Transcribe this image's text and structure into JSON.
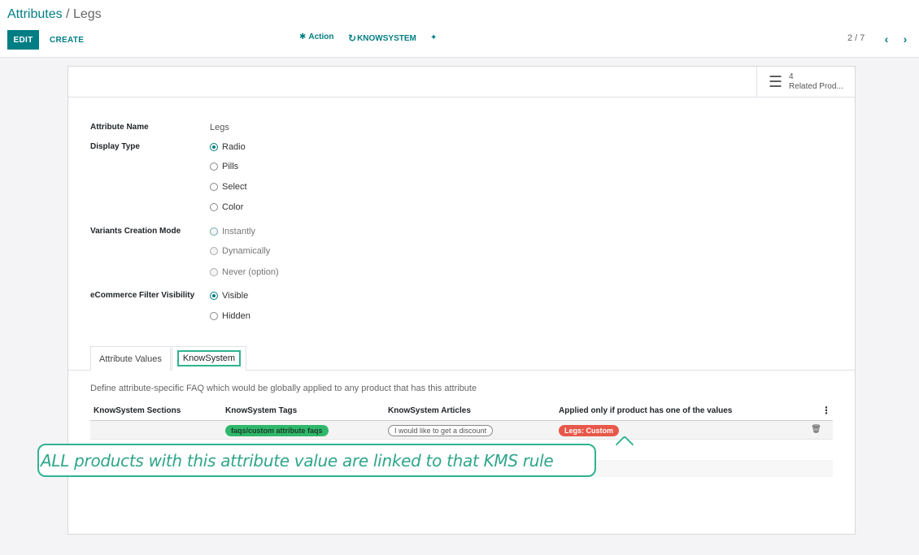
{
  "breadcrumb": {
    "parent": "Attributes",
    "separator": " / ",
    "current": "Legs"
  },
  "toolbar": {
    "edit_label": "EDIT",
    "create_label": "CREATE",
    "action_label": "Action",
    "knowsystem_label": "KNOWSYSTEM"
  },
  "pager": {
    "value": "2 / 7"
  },
  "smart_button": {
    "count": "4",
    "label": "Related Prod..."
  },
  "form": {
    "attribute_name": {
      "label": "Attribute Name",
      "value": "Legs"
    },
    "display_type": {
      "label": "Display Type",
      "options": [
        "Radio",
        "Pills",
        "Select",
        "Color"
      ],
      "selected": "Radio"
    },
    "variants_creation_mode": {
      "label": "Variants Creation Mode",
      "options": [
        "Instantly",
        "Dynamically",
        "Never (option)"
      ]
    },
    "ecommerce_filter": {
      "label": "eCommerce Filter Visibility",
      "options": [
        "Visible",
        "Hidden"
      ],
      "selected": "Visible"
    }
  },
  "tabs": [
    {
      "label": "Attribute Values"
    },
    {
      "label": "KnowSystem",
      "active": true
    }
  ],
  "knowsystem": {
    "hint": "Define attribute-specific FAQ which would be globally applied to any product that has this attribute",
    "columns": [
      "KnowSystem Sections",
      "KnowSystem Tags",
      "KnowSystem Articles",
      "Applied only if product has one of the values"
    ],
    "rows": [
      {
        "section": "",
        "tag": "faqs/custom attribute faqs",
        "article": "I would like to get a discount",
        "value": "Legs: Custom"
      }
    ]
  },
  "callout": {
    "text": "ALL products with this attribute value are linked to that KMS rule"
  },
  "colors": {
    "primary": "#017e84",
    "accent": "#2fb390",
    "tag_green": "#2fb86b",
    "value_red": "#e8584a"
  }
}
